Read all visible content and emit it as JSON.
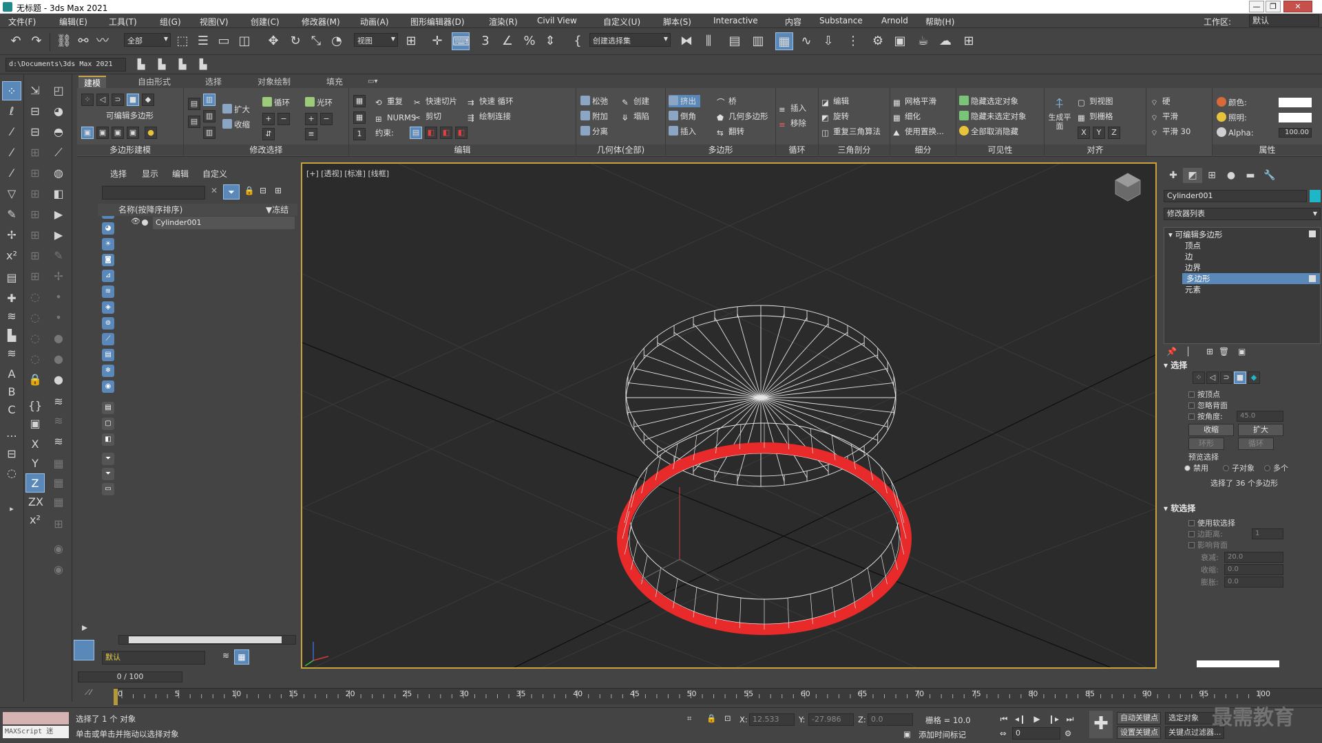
{
  "window": {
    "title": "无标题 - 3ds Max 2021",
    "minimize": "—",
    "maximize": "❐",
    "close": "✕"
  },
  "menu": [
    "文件(F)",
    "编辑(E)",
    "工具(T)",
    "组(G)",
    "视图(V)",
    "创建(C)",
    "修改器(M)",
    "动画(A)",
    "图形编辑器(D)",
    "渲染(R)",
    "Civil View",
    "自定义(U)",
    "脚本(S)",
    "Interactive",
    "内容",
    "Substance",
    "Arnold",
    "帮助(H)"
  ],
  "workspace": {
    "label": "工作区:",
    "value": "默认"
  },
  "toolbar": {
    "filter": "全部",
    "refcoord": "视图",
    "selset": "创建选择集"
  },
  "project_path": "d:\\Documents\\3ds Max 2021",
  "ribbon": {
    "tabs": [
      "建模",
      "自由形式",
      "选择",
      "对象绘制",
      "填充"
    ],
    "groups": {
      "poly_modeling": "多边形建模",
      "modify_selection": "修改选择",
      "edit": "编辑",
      "geometry": "几何体(全部)",
      "polygons": "多边形",
      "loops": "循环",
      "triangulation": "三角剖分",
      "subdivision": "细分",
      "visibility": "可见性",
      "align": "对齐",
      "properties": "属性"
    },
    "labels": {
      "editable_poly": "可编辑多边形",
      "grow": "扩大",
      "shrink": "收缩",
      "loop": "循环",
      "ring": "光环",
      "repeat": "重复",
      "quickslice": "快速切片",
      "quickloop": "快速 循环",
      "nurms": "NURMS",
      "cut": "剪切",
      "paintconnect": "绘制连接",
      "constraint": "约束:",
      "relax": "松弛",
      "create": "创建",
      "attach": "附加",
      "collapse": "塌陷",
      "detach": "分离",
      "extrude": "挤出",
      "bridge": "桥",
      "bevel": "倒角",
      "geopoly": "几何多边形",
      "inset": "插入",
      "flip": "翻转",
      "insert_loop": "插入",
      "remove_loop": "移除",
      "edit_tri": "编辑",
      "rotate_tri": "旋转",
      "retri": "重复三角算法",
      "meshsmooth": "网格平滑",
      "tessellate": "细化",
      "usedisp": "使用置换...",
      "hidesel": "隐藏选定对象",
      "hideunsel": "隐藏未选定对象",
      "unhideall": "全部取消隐藏",
      "makeplanar": "生成平面",
      "toview": "到视图",
      "togrid": "到栅格",
      "hard": "硬",
      "smooth": "平滑",
      "smooth30": "平滑 30",
      "color": "颜色:",
      "illum": "照明:",
      "alpha": "Alpha:",
      "alpha_val": "100.00"
    }
  },
  "scene_explorer": {
    "menu": [
      "选择",
      "显示",
      "编辑",
      "自定义"
    ],
    "col_name": "名称(按降序排序)",
    "col_frozen": "▼冻结",
    "rows": [
      "Cylinder001"
    ],
    "layer": "默认"
  },
  "viewport": {
    "label": "[+] [透视] [标准] [线框]"
  },
  "command_panel": {
    "object_name": "Cylinder001",
    "modifier_list": "修改器列表",
    "stack": [
      {
        "label": "可编辑多边形",
        "level": 0,
        "selected": false
      },
      {
        "label": "顶点",
        "level": 1,
        "selected": false
      },
      {
        "label": "边",
        "level": 1,
        "selected": false
      },
      {
        "label": "边界",
        "level": 1,
        "selected": false
      },
      {
        "label": "多边形",
        "level": 1,
        "selected": true
      },
      {
        "label": "元素",
        "level": 1,
        "selected": false
      }
    ],
    "selection": {
      "title": "选择",
      "by_vertex": "按顶点",
      "ignore_back": "忽略背面",
      "by_angle": "按角度:",
      "angle_val": "45.0",
      "shrink": "收缩",
      "grow": "扩大",
      "ring": "环形",
      "loop": "循环",
      "preview": "预览选择",
      "disabled": "禁用",
      "subobj": "子对象",
      "multi": "多个",
      "status": "选择了 36 个多边形"
    },
    "soft": {
      "title": "软选择",
      "use": "使用软选择",
      "edge_dist": "边距离:",
      "edge_val": "1",
      "affect_back": "影响背面",
      "falloff": "衰减:",
      "falloff_val": "20.0",
      "pinch": "收缩:",
      "pinch_val": "0.0",
      "bubble": "膨胀:",
      "bubble_val": "0.0"
    }
  },
  "timeline": {
    "slider": "0 / 100",
    "ticks": [
      "0",
      "5",
      "10",
      "15",
      "20",
      "25",
      "30",
      "35",
      "40",
      "45",
      "50",
      "55",
      "60",
      "65",
      "70",
      "75",
      "80",
      "85",
      "90",
      "95",
      "100"
    ]
  },
  "status": {
    "maxscript": "MAXScript 迷",
    "selected": "选择了 1 个 对象",
    "prompt": "单击或单击并拖动以选择对象",
    "x_label": "X:",
    "x_val": "12.533",
    "y_label": "Y:",
    "y_val": "-27.986",
    "z_label": "Z:",
    "z_val": "0.0",
    "grid": "栅格 = 10.0",
    "addtime": "添加时间标记",
    "autokey": "自动关键点",
    "setkey": "设置关键点",
    "selobj": "选定对象",
    "keyfilter": "关键点过滤器...",
    "frame": "0"
  },
  "watermark": "最需教育"
}
